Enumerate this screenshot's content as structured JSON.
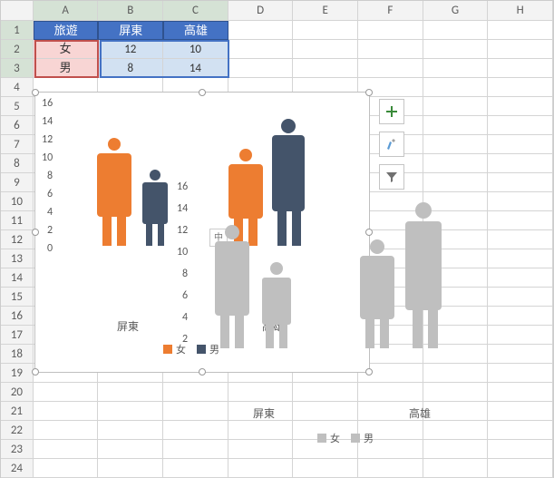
{
  "columns": [
    "A",
    "B",
    "C",
    "D",
    "E",
    "F",
    "G",
    "H"
  ],
  "rows": 24,
  "table": {
    "header": {
      "A": "旅遊",
      "B": "屏東",
      "C": "高雄"
    },
    "r2": {
      "A": "女",
      "B": "12",
      "C": "10"
    },
    "r3": {
      "A": "男",
      "B": "8",
      "C": "14"
    }
  },
  "chart_data": [
    {
      "type": "bar",
      "categories": [
        "屏東",
        "高雄"
      ],
      "series": [
        {
          "name": "女",
          "values": [
            12,
            10
          ],
          "color": "#ed7d31"
        },
        {
          "name": "男",
          "values": [
            8,
            14
          ],
          "color": "#44546a"
        }
      ],
      "ylabel": "",
      "xlabel": "",
      "ylim": [
        0,
        16
      ],
      "yticks": [
        0,
        2,
        4,
        6,
        8,
        10,
        12,
        14,
        16
      ],
      "legend": [
        "女",
        "男"
      ],
      "shape": "person"
    },
    {
      "type": "bar",
      "categories": [
        "屏東",
        "高雄"
      ],
      "series": [
        {
          "name": "女",
          "values": [
            12,
            10
          ],
          "color": "#bfbfbf"
        },
        {
          "name": "男",
          "values": [
            8,
            14
          ],
          "color": "#bfbfbf"
        }
      ],
      "ylim": [
        0,
        16
      ],
      "yticks": [
        2,
        4,
        6,
        8,
        10,
        12,
        14,
        16
      ],
      "legend": [
        "女",
        "男"
      ],
      "shape": "person"
    }
  ],
  "legend_items": {
    "f": "女",
    "m": "男"
  },
  "side_buttons": {
    "plus": "+",
    "brush": "brush",
    "filter": "filter"
  },
  "inner_btn": "中"
}
